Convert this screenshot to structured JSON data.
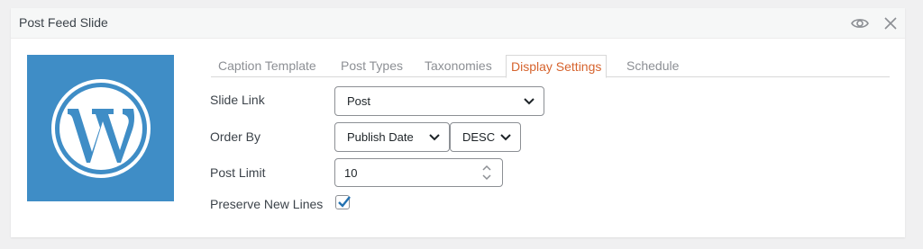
{
  "panel": {
    "title": "Post Feed Slide",
    "icons": {
      "preview": "eye-icon",
      "close": "close-icon"
    }
  },
  "logo": {
    "name": "wordpress-logo-icon",
    "background": "#3f8dc6"
  },
  "tabs": [
    {
      "label": "Caption Template",
      "active": false
    },
    {
      "label": "Post Types",
      "active": false
    },
    {
      "label": "Taxonomies",
      "active": false
    },
    {
      "label": "Display Settings",
      "active": true
    },
    {
      "label": "Schedule",
      "active": false
    }
  ],
  "form": {
    "slide_link": {
      "label": "Slide Link",
      "value": "Post"
    },
    "order_by": {
      "label": "Order By",
      "field": "Publish Date",
      "direction": "DESC"
    },
    "post_limit": {
      "label": "Post Limit",
      "value": "10"
    },
    "preserve_new_lines": {
      "label": "Preserve New Lines",
      "checked": true
    }
  },
  "colors": {
    "active_tab": "#d6632d",
    "check": "#2271b1",
    "logo_bg": "#3f8dc6"
  }
}
